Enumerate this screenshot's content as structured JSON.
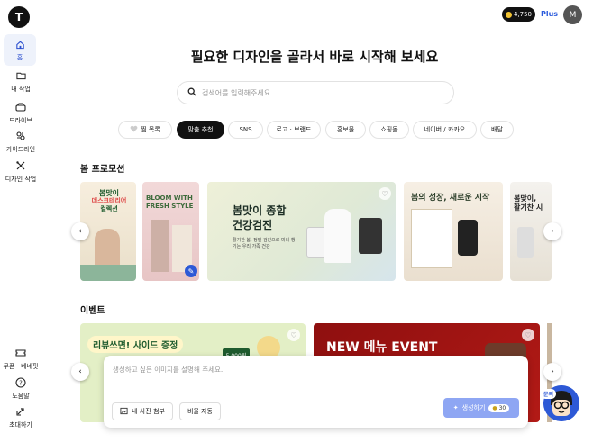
{
  "app": {
    "logo_letter": "T"
  },
  "sidebar": {
    "items": [
      {
        "label": "홈"
      },
      {
        "label": "내 작업"
      },
      {
        "label": "드라이브"
      },
      {
        "label": "가이드라인"
      },
      {
        "label": "디자인 작업"
      }
    ],
    "bottom_items": [
      {
        "label": "쿠폰 · 베네핏"
      },
      {
        "label": "도움말"
      },
      {
        "label": "초대하기"
      }
    ]
  },
  "topbar": {
    "credits": "4,750",
    "plus_label": "Plus",
    "avatar_letter": "M"
  },
  "main": {
    "headline": "필요한 디자인을 골라서 바로 시작해 보세요",
    "search_placeholder": "검색어를 입력해주세요.",
    "chips": [
      "찜 목록",
      "맞춤 추천",
      "SNS",
      "로고 · 브랜드",
      "홍보물",
      "쇼핑몰",
      "네이버 / 카카오",
      "배달"
    ],
    "active_chip_index": 1,
    "promo_section_title": "봄 프로모션",
    "event_section_title": "이벤트"
  },
  "promo_cards": [
    {
      "title_line1": "봄맞이",
      "title_line2": "데스크테리어",
      "title_line3": "컬렉션"
    },
    {
      "title_line1": "BLOOM WITH",
      "title_line2": "FRESH STYLE"
    },
    {
      "title_line1": "봄맞이 종합",
      "title_line2": "건강검진",
      "body": "활기찬 봄, 정밀 검진으로 미리 챙기는 우리 가족 건강"
    },
    {
      "title_line1": "봄의 성장, 새로운 시작"
    },
    {
      "title_line1": "봄맞이,",
      "title_line2": "활기찬 시"
    }
  ],
  "event_cards": [
    {
      "title": "리뷰쓰면! 사이드 증정",
      "price": "5,000원"
    },
    {
      "title": "NEW 메뉴 EVENT"
    }
  ],
  "prompt": {
    "placeholder": "생성하고 싶은 이미지를 설명해 주세요.",
    "attach_label": "내 사진 첨부",
    "ratio_label": "비율 자동",
    "generate_label": "생성하기",
    "generate_cost": "30"
  },
  "helper": {
    "badge": "문의"
  },
  "colors": {
    "accent": "#2b5bdc",
    "active_chip": "#111111",
    "generate_button": "#8ea6f3"
  }
}
